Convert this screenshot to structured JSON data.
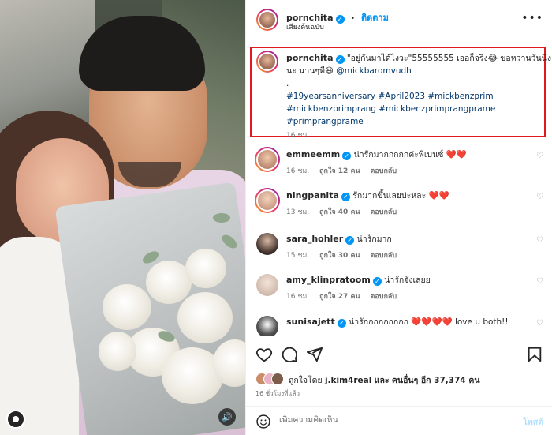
{
  "colors": {
    "accent": "#0095f6",
    "highlight_box": "#e0191e",
    "heart": "#ed1c24"
  },
  "header": {
    "username": "pornchita",
    "separator": "•",
    "follow_label": "ติดตาม",
    "subtitle": "เสียงต้นฉบับ",
    "more_icon": "more-horizontal-icon"
  },
  "caption": {
    "username": "pornchita",
    "text_line1": "\"อยู่กันมาได้ไงวะ\"55555555 เออก็จริง😂 ขอหวานวันนึ่ง",
    "text_line2_prefix": "นะ นานๆที😆",
    "mention": "@mickbaromvudh",
    "dot": ".",
    "hashtags_line1": "#19yearsanniversary #April2023 #mickbenzprim",
    "hashtags_line2": "#mickbenzprimprang #mickbenzprimprangprame",
    "hashtags_line3": "#primprangprame",
    "time": "16 ชม."
  },
  "comments": [
    {
      "username": "emmeemm",
      "text": "น่ารักมากกกกกค่ะพี่เบนซ์",
      "hearts": "❤️❤️",
      "extra": "",
      "time": "16 ชม.",
      "likes": "ถูกใจ 12 คน",
      "reply": "ตอบกลับ"
    },
    {
      "username": "ningpanita",
      "text": "รักมากขึ้นเลยปะหละ",
      "hearts": "❤️❤️",
      "extra": "",
      "time": "13 ชม.",
      "likes": "ถูกใจ 40 คน",
      "reply": "ตอบกลับ"
    },
    {
      "username": "sara_hohler",
      "text": "น่ารักมาก",
      "hearts": "",
      "extra": "",
      "time": "15 ชม.",
      "likes": "ถูกใจ 30 คน",
      "reply": "ตอบกลับ"
    },
    {
      "username": "amy_klinpratoom",
      "text": "น่ารักจังเลยย",
      "hearts": "",
      "extra": "",
      "time": "16 ชม.",
      "likes": "ถูกใจ 27 คน",
      "reply": "ตอบกลับ"
    },
    {
      "username": "sunisajett",
      "text": "น่ารักกกกกกกกก",
      "hearts": "❤️❤️❤️❤️",
      "extra": "love u both!!",
      "time": "",
      "likes": "",
      "reply": ""
    }
  ],
  "actions": {
    "like_icon": "heart-icon",
    "comment_icon": "comment-icon",
    "share_icon": "send-icon",
    "save_icon": "bookmark-icon",
    "liked_by_prefix": "ถูกใจโดย",
    "liked_by_user": "j.kim4real",
    "liked_by_middle": "และ",
    "liked_by_others": "คนอื่นๆ อีก 37,374 คน",
    "time_ago": "16 ชั่วโมงที่แล้ว"
  },
  "add_comment": {
    "placeholder": "เพิ่มความคิดเห็น",
    "post_label": "โพสต์",
    "emoji_icon": "emoji-icon"
  },
  "photo": {
    "avatar_icon": "user-tag-icon",
    "sound_icon": "speaker-icon"
  }
}
